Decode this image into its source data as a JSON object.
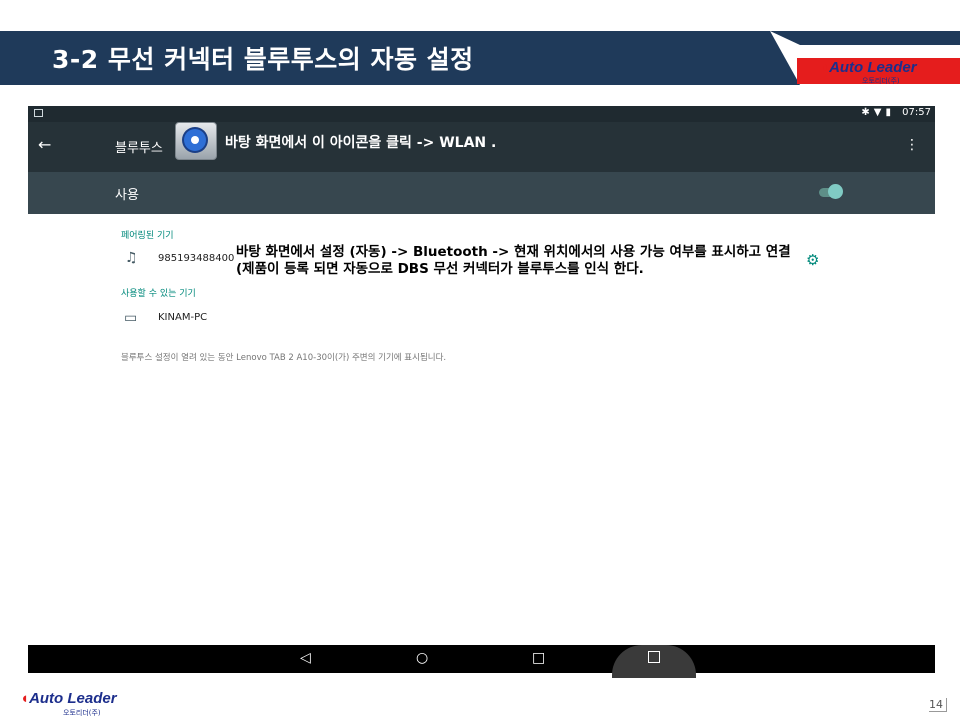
{
  "slide": {
    "title": "3-2 무선 커넥터 블루투스의 자동 설정",
    "logo_text": "Auto Leader",
    "logo_sub": "오토리더(주)",
    "page_number": "14"
  },
  "statusbar": {
    "time": "07:57"
  },
  "appbar": {
    "title": "블루투스",
    "annotation": "바탕 화면에서 이 아이콘을 클릭 -> WLAN ."
  },
  "toggle": {
    "label": "사용",
    "state": "on"
  },
  "paired": {
    "header": "페어링된 기기",
    "devices": [
      {
        "name": "985193488400",
        "icon": "headphones-icon"
      }
    ]
  },
  "available": {
    "header": "사용할 수 있는 기기",
    "devices": [
      {
        "name": "KINAM-PC",
        "icon": "laptop-icon"
      }
    ]
  },
  "annotation2": "바탕 화면에서 설정 (자동) -> Bluetooth -> 현재 위치에서의 사용 가능 여부를 표시하고 연결(제품이 등록 되면 자동으로 DBS 무선 커넥터가 블루투스를 인식 한다.",
  "footnote": "블루투스 설정이 열려 있는 동안 Lenovo TAB 2 A10-30이(가) 주변의 기기에 표시됩니다.",
  "colors": {
    "accent": "#00897b",
    "title_band": "#1f3a5a",
    "logo_red": "#e51d1d"
  }
}
